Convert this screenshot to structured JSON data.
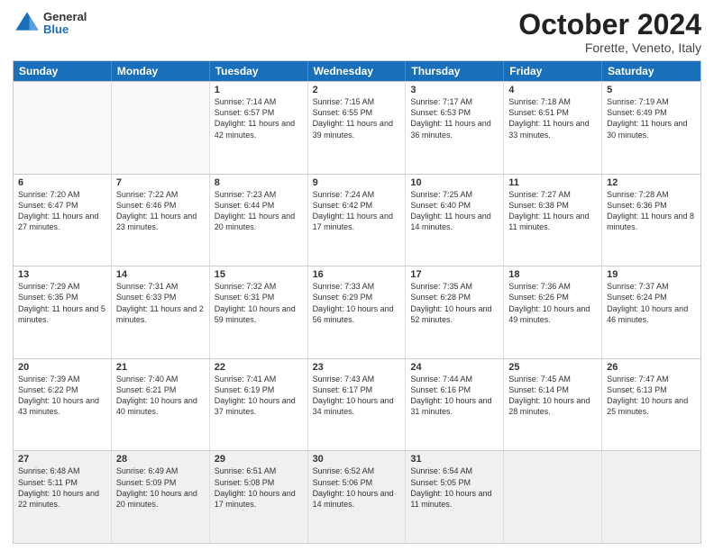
{
  "header": {
    "logo": {
      "line1": "General",
      "line2": "Blue"
    },
    "month_title": "October 2024",
    "location": "Forette, Veneto, Italy"
  },
  "weekdays": [
    "Sunday",
    "Monday",
    "Tuesday",
    "Wednesday",
    "Thursday",
    "Friday",
    "Saturday"
  ],
  "weeks": [
    [
      {
        "day": "",
        "sunrise": "",
        "sunset": "",
        "daylight": "",
        "empty": true
      },
      {
        "day": "",
        "sunrise": "",
        "sunset": "",
        "daylight": "",
        "empty": true
      },
      {
        "day": "1",
        "sunrise": "Sunrise: 7:14 AM",
        "sunset": "Sunset: 6:57 PM",
        "daylight": "Daylight: 11 hours and 42 minutes.",
        "empty": false
      },
      {
        "day": "2",
        "sunrise": "Sunrise: 7:15 AM",
        "sunset": "Sunset: 6:55 PM",
        "daylight": "Daylight: 11 hours and 39 minutes.",
        "empty": false
      },
      {
        "day": "3",
        "sunrise": "Sunrise: 7:17 AM",
        "sunset": "Sunset: 6:53 PM",
        "daylight": "Daylight: 11 hours and 36 minutes.",
        "empty": false
      },
      {
        "day": "4",
        "sunrise": "Sunrise: 7:18 AM",
        "sunset": "Sunset: 6:51 PM",
        "daylight": "Daylight: 11 hours and 33 minutes.",
        "empty": false
      },
      {
        "day": "5",
        "sunrise": "Sunrise: 7:19 AM",
        "sunset": "Sunset: 6:49 PM",
        "daylight": "Daylight: 11 hours and 30 minutes.",
        "empty": false
      }
    ],
    [
      {
        "day": "6",
        "sunrise": "Sunrise: 7:20 AM",
        "sunset": "Sunset: 6:47 PM",
        "daylight": "Daylight: 11 hours and 27 minutes.",
        "empty": false
      },
      {
        "day": "7",
        "sunrise": "Sunrise: 7:22 AM",
        "sunset": "Sunset: 6:46 PM",
        "daylight": "Daylight: 11 hours and 23 minutes.",
        "empty": false
      },
      {
        "day": "8",
        "sunrise": "Sunrise: 7:23 AM",
        "sunset": "Sunset: 6:44 PM",
        "daylight": "Daylight: 11 hours and 20 minutes.",
        "empty": false
      },
      {
        "day": "9",
        "sunrise": "Sunrise: 7:24 AM",
        "sunset": "Sunset: 6:42 PM",
        "daylight": "Daylight: 11 hours and 17 minutes.",
        "empty": false
      },
      {
        "day": "10",
        "sunrise": "Sunrise: 7:25 AM",
        "sunset": "Sunset: 6:40 PM",
        "daylight": "Daylight: 11 hours and 14 minutes.",
        "empty": false
      },
      {
        "day": "11",
        "sunrise": "Sunrise: 7:27 AM",
        "sunset": "Sunset: 6:38 PM",
        "daylight": "Daylight: 11 hours and 11 minutes.",
        "empty": false
      },
      {
        "day": "12",
        "sunrise": "Sunrise: 7:28 AM",
        "sunset": "Sunset: 6:36 PM",
        "daylight": "Daylight: 11 hours and 8 minutes.",
        "empty": false
      }
    ],
    [
      {
        "day": "13",
        "sunrise": "Sunrise: 7:29 AM",
        "sunset": "Sunset: 6:35 PM",
        "daylight": "Daylight: 11 hours and 5 minutes.",
        "empty": false
      },
      {
        "day": "14",
        "sunrise": "Sunrise: 7:31 AM",
        "sunset": "Sunset: 6:33 PM",
        "daylight": "Daylight: 11 hours and 2 minutes.",
        "empty": false
      },
      {
        "day": "15",
        "sunrise": "Sunrise: 7:32 AM",
        "sunset": "Sunset: 6:31 PM",
        "daylight": "Daylight: 10 hours and 59 minutes.",
        "empty": false
      },
      {
        "day": "16",
        "sunrise": "Sunrise: 7:33 AM",
        "sunset": "Sunset: 6:29 PM",
        "daylight": "Daylight: 10 hours and 56 minutes.",
        "empty": false
      },
      {
        "day": "17",
        "sunrise": "Sunrise: 7:35 AM",
        "sunset": "Sunset: 6:28 PM",
        "daylight": "Daylight: 10 hours and 52 minutes.",
        "empty": false
      },
      {
        "day": "18",
        "sunrise": "Sunrise: 7:36 AM",
        "sunset": "Sunset: 6:26 PM",
        "daylight": "Daylight: 10 hours and 49 minutes.",
        "empty": false
      },
      {
        "day": "19",
        "sunrise": "Sunrise: 7:37 AM",
        "sunset": "Sunset: 6:24 PM",
        "daylight": "Daylight: 10 hours and 46 minutes.",
        "empty": false
      }
    ],
    [
      {
        "day": "20",
        "sunrise": "Sunrise: 7:39 AM",
        "sunset": "Sunset: 6:22 PM",
        "daylight": "Daylight: 10 hours and 43 minutes.",
        "empty": false
      },
      {
        "day": "21",
        "sunrise": "Sunrise: 7:40 AM",
        "sunset": "Sunset: 6:21 PM",
        "daylight": "Daylight: 10 hours and 40 minutes.",
        "empty": false
      },
      {
        "day": "22",
        "sunrise": "Sunrise: 7:41 AM",
        "sunset": "Sunset: 6:19 PM",
        "daylight": "Daylight: 10 hours and 37 minutes.",
        "empty": false
      },
      {
        "day": "23",
        "sunrise": "Sunrise: 7:43 AM",
        "sunset": "Sunset: 6:17 PM",
        "daylight": "Daylight: 10 hours and 34 minutes.",
        "empty": false
      },
      {
        "day": "24",
        "sunrise": "Sunrise: 7:44 AM",
        "sunset": "Sunset: 6:16 PM",
        "daylight": "Daylight: 10 hours and 31 minutes.",
        "empty": false
      },
      {
        "day": "25",
        "sunrise": "Sunrise: 7:45 AM",
        "sunset": "Sunset: 6:14 PM",
        "daylight": "Daylight: 10 hours and 28 minutes.",
        "empty": false
      },
      {
        "day": "26",
        "sunrise": "Sunrise: 7:47 AM",
        "sunset": "Sunset: 6:13 PM",
        "daylight": "Daylight: 10 hours and 25 minutes.",
        "empty": false
      }
    ],
    [
      {
        "day": "27",
        "sunrise": "Sunrise: 6:48 AM",
        "sunset": "Sunset: 5:11 PM",
        "daylight": "Daylight: 10 hours and 22 minutes.",
        "empty": false
      },
      {
        "day": "28",
        "sunrise": "Sunrise: 6:49 AM",
        "sunset": "Sunset: 5:09 PM",
        "daylight": "Daylight: 10 hours and 20 minutes.",
        "empty": false
      },
      {
        "day": "29",
        "sunrise": "Sunrise: 6:51 AM",
        "sunset": "Sunset: 5:08 PM",
        "daylight": "Daylight: 10 hours and 17 minutes.",
        "empty": false
      },
      {
        "day": "30",
        "sunrise": "Sunrise: 6:52 AM",
        "sunset": "Sunset: 5:06 PM",
        "daylight": "Daylight: 10 hours and 14 minutes.",
        "empty": false
      },
      {
        "day": "31",
        "sunrise": "Sunrise: 6:54 AM",
        "sunset": "Sunset: 5:05 PM",
        "daylight": "Daylight: 10 hours and 11 minutes.",
        "empty": false
      },
      {
        "day": "",
        "sunrise": "",
        "sunset": "",
        "daylight": "",
        "empty": true
      },
      {
        "day": "",
        "sunrise": "",
        "sunset": "",
        "daylight": "",
        "empty": true
      }
    ]
  ]
}
